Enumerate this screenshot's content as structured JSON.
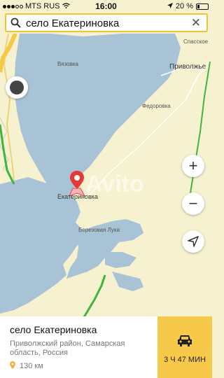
{
  "status": {
    "carrier": "MTS RUS",
    "time": "16:00",
    "battery": "20 %"
  },
  "search": {
    "query": "село Екатериновка"
  },
  "map": {
    "labels": {
      "spasskoe": "Спасское",
      "vyazovka": "Вязовка",
      "privolzhye": "Приволжье",
      "fedorovka": "Федоровка",
      "ekaterinovka": "Екатериновка",
      "berezovaya": "Березовая Лука"
    },
    "watermark": "Avito"
  },
  "place": {
    "name": "село Екатериновка",
    "address": "Приволжский район, Самарская область, Россия",
    "distance": "130 км"
  },
  "route": {
    "time": "3 Ч 47 МИН"
  }
}
